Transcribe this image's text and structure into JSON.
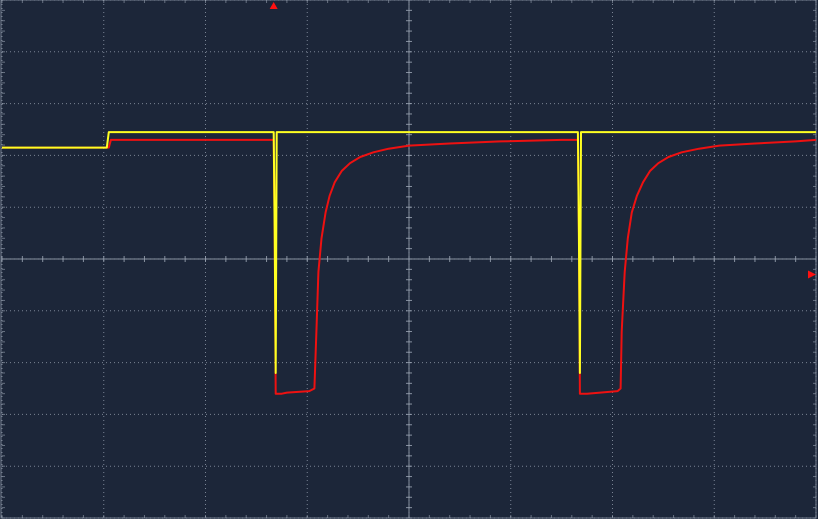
{
  "colors": {
    "background": "#1c2639",
    "grid": "#9aa4b3",
    "channel_1": "#ffff22",
    "channel_2": "#ee1111",
    "marker": "#ff1111"
  },
  "markers": {
    "trigger_position": "top",
    "trigger_level": "right"
  },
  "chart_data": {
    "type": "line",
    "title": "",
    "xlabel": "",
    "ylabel": "",
    "x_divisions": 8,
    "y_divisions": 10,
    "subdivisions_per_division": 5,
    "xlim": [
      0,
      8
    ],
    "ylim": [
      -5,
      5
    ],
    "grid": true,
    "series": [
      {
        "color": "#ffff22",
        "x": [
          0,
          1.03,
          1.05,
          2.67,
          2.68,
          2.69,
          2.7,
          3.73,
          4.2,
          4.4,
          5.5,
          5.66,
          5.67,
          5.68,
          5.69,
          6.5,
          8
        ],
        "y": [
          2.15,
          2.15,
          2.45,
          2.45,
          0.5,
          -2.2,
          2.45,
          2.45,
          2.45,
          2.45,
          2.45,
          2.45,
          0.5,
          -2.2,
          2.45,
          2.45,
          2.45
        ]
      },
      {
        "color": "#ee1111",
        "x": [
          0,
          1.05,
          1.07,
          2.67,
          2.68,
          2.69,
          2.7,
          2.75,
          2.8,
          3.02,
          3.07,
          3.09,
          3.11,
          3.14,
          3.18,
          3.22,
          3.27,
          3.34,
          3.42,
          3.52,
          3.65,
          3.8,
          4.0,
          4.4,
          4.9,
          5.5,
          5.66,
          5.67,
          5.68,
          5.69,
          5.75,
          6.05,
          6.08,
          6.09,
          6.12,
          6.15,
          6.19,
          6.24,
          6.3,
          6.37,
          6.45,
          6.55,
          6.68,
          6.85,
          7.05,
          7.4,
          7.8,
          8
        ],
        "y": [
          2.15,
          2.15,
          2.3,
          2.3,
          0.5,
          -2.6,
          -2.6,
          -2.6,
          -2.58,
          -2.55,
          -2.5,
          -1.4,
          -0.25,
          0.4,
          0.9,
          1.22,
          1.48,
          1.7,
          1.85,
          1.97,
          2.06,
          2.13,
          2.19,
          2.23,
          2.27,
          2.3,
          2.3,
          0.5,
          -2.6,
          -2.6,
          -2.6,
          -2.55,
          -2.5,
          -1.4,
          -0.25,
          0.4,
          0.9,
          1.22,
          1.48,
          1.7,
          1.85,
          1.97,
          2.06,
          2.13,
          2.19,
          2.23,
          2.27,
          2.3
        ]
      }
    ]
  }
}
